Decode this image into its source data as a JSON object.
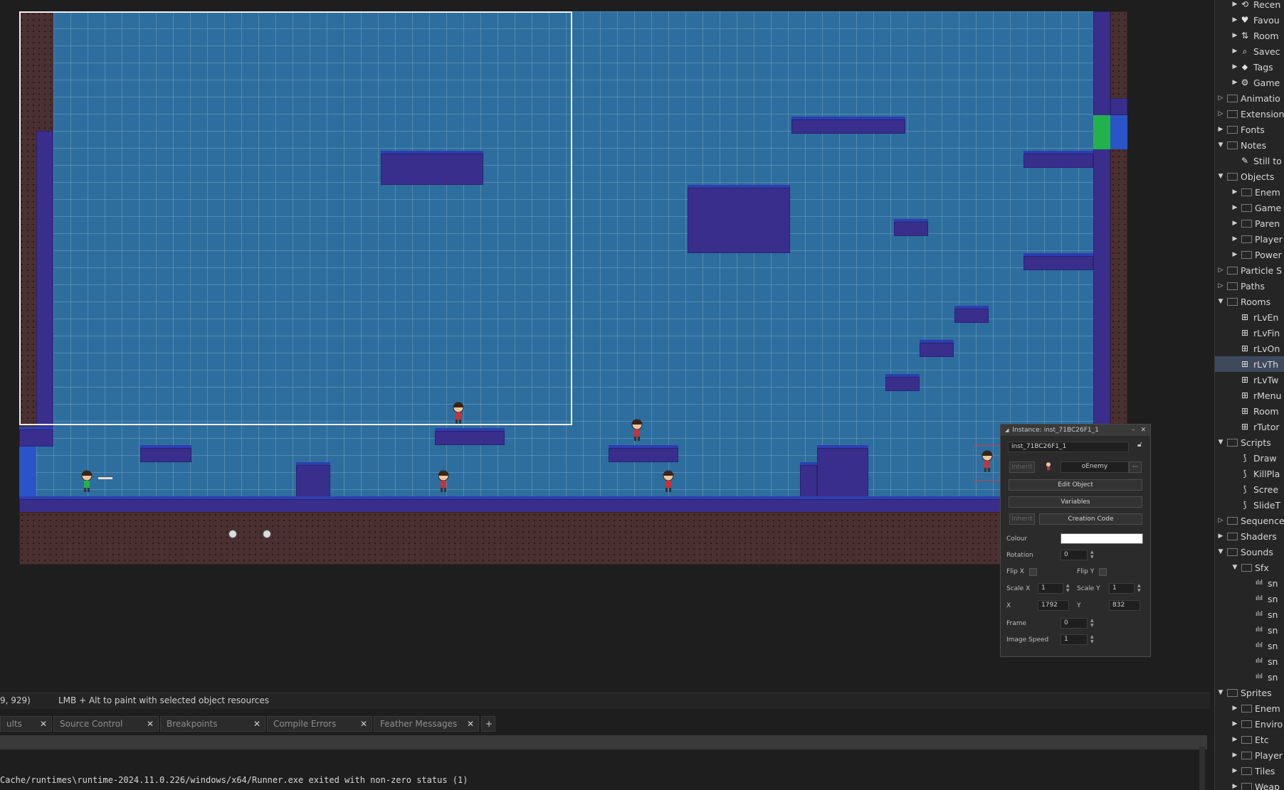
{
  "status": {
    "coords": "9, 929)",
    "hint": "LMB + Alt to paint with selected object resources"
  },
  "tabs": [
    {
      "label": "ults"
    },
    {
      "label": "Source Control"
    },
    {
      "label": "Breakpoints"
    },
    {
      "label": "Compile Errors"
    },
    {
      "label": "Feather Messages"
    }
  ],
  "tabs_add": "+",
  "output_line": "Cache/runtimes\\runtime-2024.11.0.226/windows/x64/Runner.exe exited with non-zero status (1)",
  "instance": {
    "title": "Instance: inst_71BC26F1_1",
    "name": "inst_71BC26F1_1",
    "inherit": "Inherit",
    "object": "oEnemy",
    "object_menu": "···",
    "edit_object": "Edit Object",
    "variables": "Variables",
    "creation_code": "Creation Code",
    "colour_label": "Colour",
    "colour_value": "#ffffff",
    "rotation_label": "Rotation",
    "rotation": "0",
    "flipx_label": "Flip X",
    "flipy_label": "Flip Y",
    "scalex_label": "Scale X",
    "scalex": "1",
    "scaley_label": "Scale Y",
    "scaley": "1",
    "x_label": "X",
    "x": "1792",
    "y_label": "Y",
    "y": "832",
    "frame_label": "Frame",
    "frame": "0",
    "speed_label": "Image Speed",
    "speed": "1"
  },
  "tree": {
    "items": [
      {
        "label": "Recen",
        "icon": "recent-icon"
      },
      {
        "label": "Favou",
        "icon": "heart-icon"
      },
      {
        "label": "Room",
        "icon": "room-order-icon"
      },
      {
        "label": "Savec",
        "icon": "search-icon"
      },
      {
        "label": "Tags",
        "icon": "tag-icon"
      },
      {
        "label": "Game",
        "icon": "gear-icon"
      },
      {
        "label": "Animatio"
      },
      {
        "label": "Extension"
      },
      {
        "label": "Fonts"
      },
      {
        "label": "Notes"
      },
      {
        "label": "Still to"
      },
      {
        "label": "Objects"
      },
      {
        "label": "Enem"
      },
      {
        "label": "Game"
      },
      {
        "label": "Paren"
      },
      {
        "label": "Player"
      },
      {
        "label": "Power"
      },
      {
        "label": "Particle S"
      },
      {
        "label": "Paths"
      },
      {
        "label": "Rooms"
      },
      {
        "label": "rLvEn"
      },
      {
        "label": "rLvFin"
      },
      {
        "label": "rLvOn"
      },
      {
        "label": "rLvTh"
      },
      {
        "label": "rLvTw"
      },
      {
        "label": "rMenu"
      },
      {
        "label": "Room"
      },
      {
        "label": "rTutor"
      },
      {
        "label": "Scripts"
      },
      {
        "label": "Draw"
      },
      {
        "label": "KillPla"
      },
      {
        "label": "Scree"
      },
      {
        "label": "SlideT"
      },
      {
        "label": "Sequence"
      },
      {
        "label": "Shaders"
      },
      {
        "label": "Sounds"
      },
      {
        "label": "Sfx"
      },
      {
        "label": "sn"
      },
      {
        "label": "sn"
      },
      {
        "label": "sn"
      },
      {
        "label": "sn"
      },
      {
        "label": "sn"
      },
      {
        "label": "sn"
      },
      {
        "label": "sn"
      },
      {
        "label": "Sprites"
      },
      {
        "label": "Enem"
      },
      {
        "label": "Enviro"
      },
      {
        "label": "Etc"
      },
      {
        "label": "Player"
      },
      {
        "label": "Tiles"
      },
      {
        "label": "Weap"
      }
    ]
  }
}
